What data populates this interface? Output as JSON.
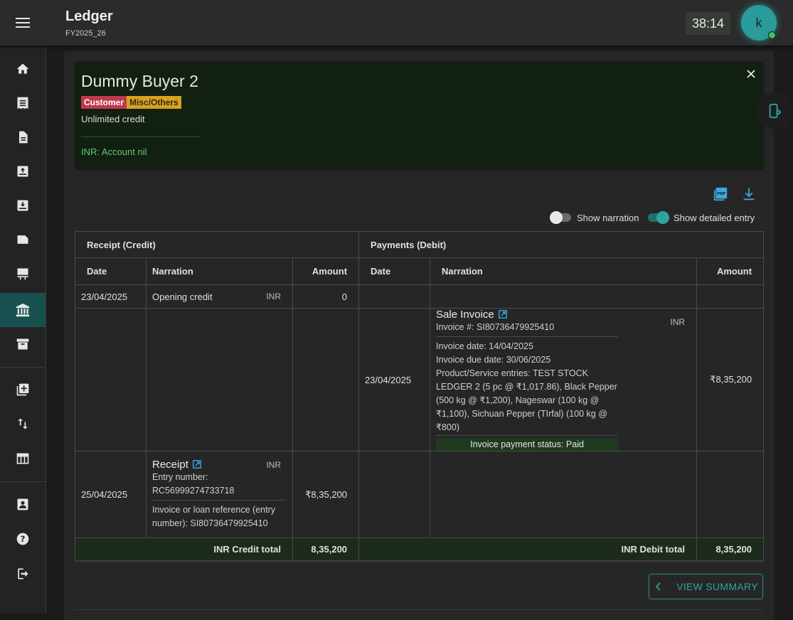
{
  "header": {
    "title": "Ledger",
    "subtitle": "FY2025_26",
    "timer": "38:14",
    "avatar_initial": "k"
  },
  "sidebar": {
    "items": [
      "home-icon",
      "receipt-icon",
      "document-icon",
      "inbox-in-icon",
      "inbox-out-icon",
      "label-icon",
      "counter-icon",
      "bank-icon",
      "archive-icon",
      "add-box-icon",
      "swap-vert-icon",
      "table-icon",
      "assignment-icon",
      "help-icon",
      "logout-icon"
    ],
    "active": "bank-icon"
  },
  "customer": {
    "name": "Dummy Buyer 2",
    "chip_customer": "Customer",
    "chip_misc": "Misc/Others",
    "credit": "Unlimited credit",
    "inr_label": "INR:",
    "inr_status": "Account nil"
  },
  "toggles": {
    "narration": "Show narration",
    "narration_on": false,
    "detailed": "Show detailed entry",
    "detailed_on": true
  },
  "table": {
    "credit_group": "Receipt (Credit)",
    "debit_group": "Payments (Debit)",
    "col_date": "Date",
    "col_narration": "Narration",
    "col_amount": "Amount",
    "row1": {
      "date": "23/04/2025",
      "narration": "Opening credit",
      "currency": "INR",
      "amount": "0"
    },
    "row2": {
      "date": "23/04/2025",
      "title": "Sale Invoice",
      "currency": "INR",
      "invoice_no": "Invoice #: SI80736479925410",
      "invoice_date": "Invoice date: 14/04/2025",
      "due_date": "Invoice due date: 30/06/2025",
      "entries": "Product/Service entries: TEST STOCK LEDGER 2 (5 pc @ ₹1,017.86), Black Pepper (500 kg @ ₹1,200), Nageswar (100 kg @ ₹1,100), Sichuan Pepper (TIrfal) (100 kg @ ₹800)",
      "status": "Invoice payment status: Paid",
      "amount": "₹8,35,200"
    },
    "row3": {
      "date": "25/04/2025",
      "title": "Receipt",
      "currency": "INR",
      "entry_label": "Entry number:",
      "entry_no": "RC56999274733718",
      "reference": "Invoice or loan reference (entry number): SI80736479925410",
      "amount": "₹8,35,200"
    },
    "credit_total_label": "INR Credit total",
    "credit_total": "8,35,200",
    "debit_total_label": "INR Debit total",
    "debit_total": "8,35,200"
  },
  "actions": {
    "view_summary": "VIEW SUMMARY"
  }
}
